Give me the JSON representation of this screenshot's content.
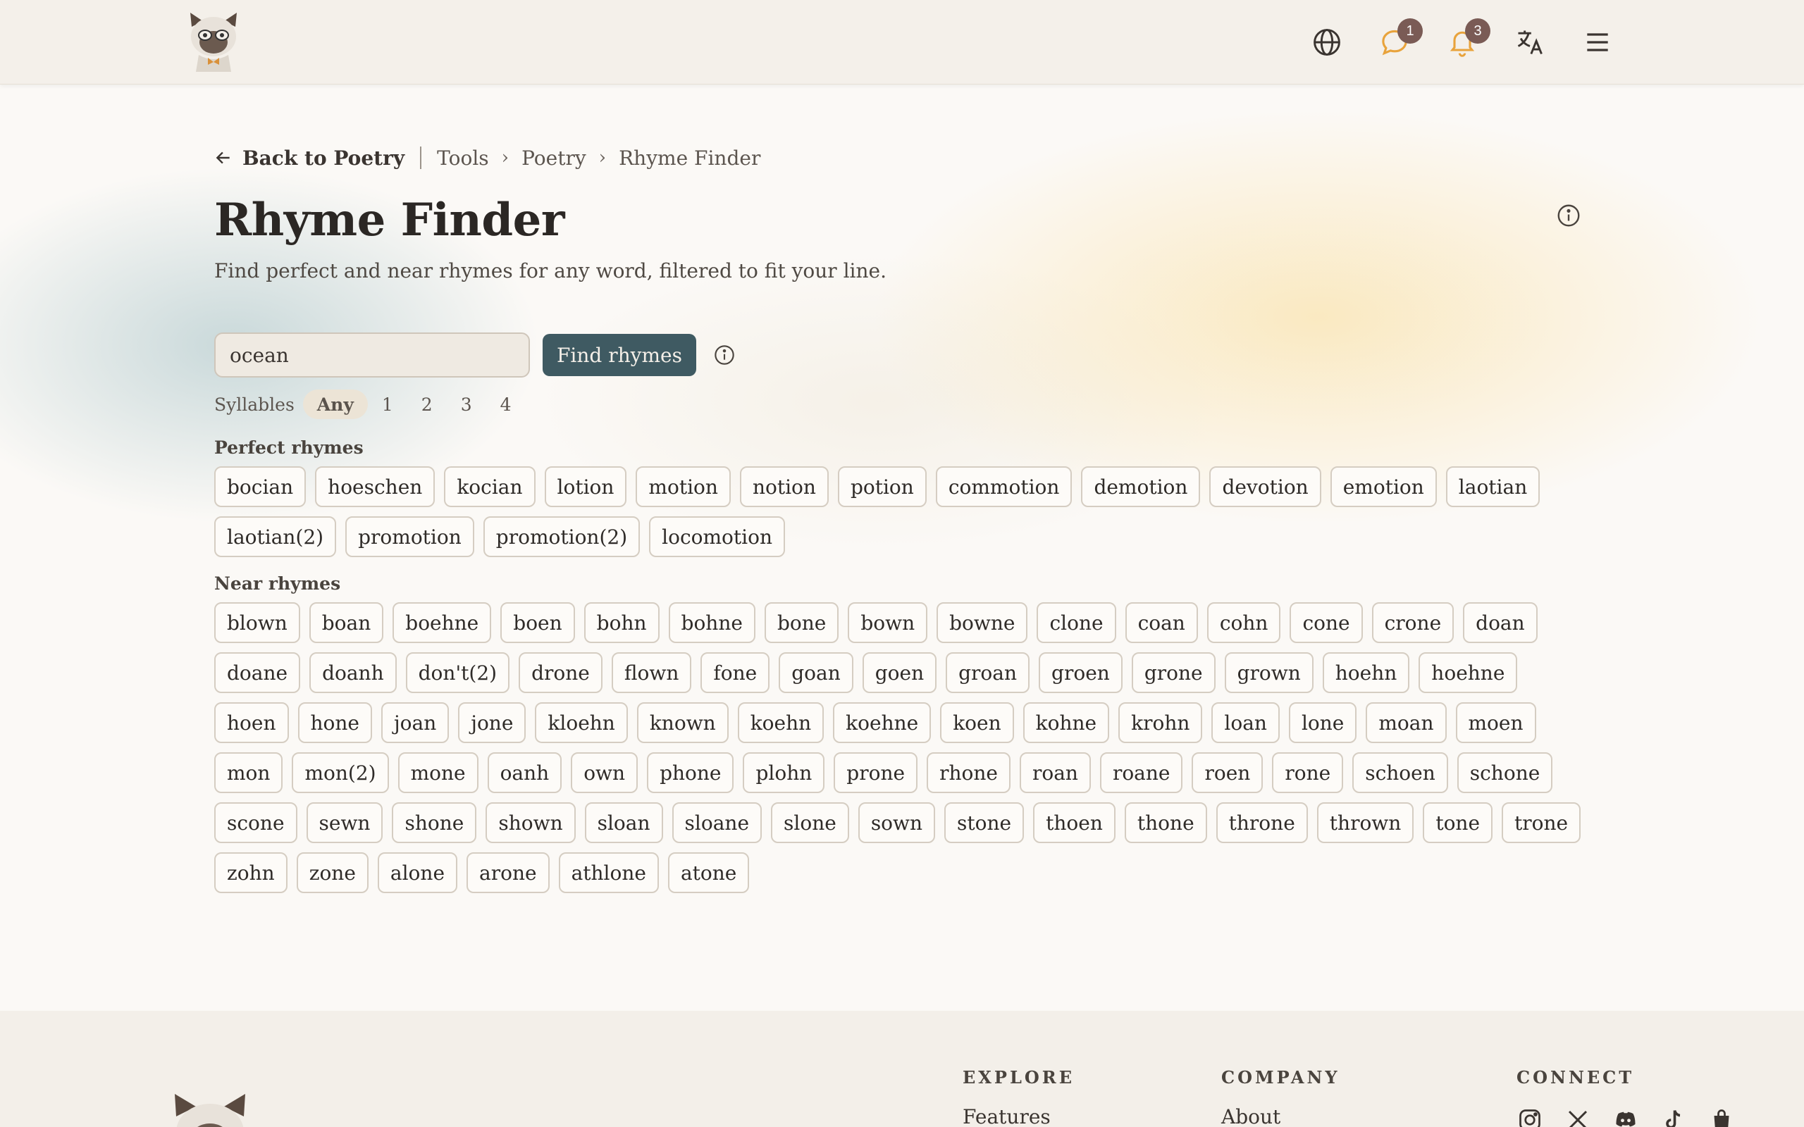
{
  "header": {
    "logo_alt": "cat mascot logo",
    "icons": [
      {
        "name": "globe-icon"
      },
      {
        "name": "chat-icon",
        "badge": "1",
        "color": "#e8a33c"
      },
      {
        "name": "bell-icon",
        "badge": "3",
        "color": "#e8a33c"
      },
      {
        "name": "translate-icon"
      },
      {
        "name": "menu-icon"
      }
    ]
  },
  "breadcrumb": {
    "back_label": "Back to Poetry",
    "items": [
      "Tools",
      "Poetry",
      "Rhyme Finder"
    ]
  },
  "page": {
    "title": "Rhyme Finder",
    "subtitle": "Find perfect and near rhymes for any word, filtered to fit your line."
  },
  "search": {
    "value": "ocean",
    "button_label": "Find rhymes"
  },
  "syllables": {
    "label": "Syllables",
    "options": [
      "Any",
      "1",
      "2",
      "3",
      "4"
    ],
    "selected": "Any"
  },
  "perfect": {
    "heading": "Perfect rhymes",
    "words": [
      "bocian",
      "hoeschen",
      "kocian",
      "lotion",
      "motion",
      "notion",
      "potion",
      "commotion",
      "demotion",
      "devotion",
      "emotion",
      "laotian",
      "laotian(2)",
      "promotion",
      "promotion(2)",
      "locomotion"
    ]
  },
  "near": {
    "heading": "Near rhymes",
    "words": [
      "blown",
      "boan",
      "boehne",
      "boen",
      "bohn",
      "bohne",
      "bone",
      "bown",
      "bowne",
      "clone",
      "coan",
      "cohn",
      "cone",
      "crone",
      "doan",
      "doane",
      "doanh",
      "don't(2)",
      "drone",
      "flown",
      "fone",
      "goan",
      "goen",
      "groan",
      "groen",
      "grone",
      "grown",
      "hoehn",
      "hoehne",
      "hoen",
      "hone",
      "joan",
      "jone",
      "kloehn",
      "known",
      "koehn",
      "koehne",
      "koen",
      "kohne",
      "krohn",
      "loan",
      "lone",
      "moan",
      "moen",
      "mon",
      "mon(2)",
      "mone",
      "oanh",
      "own",
      "phone",
      "plohn",
      "prone",
      "rhone",
      "roan",
      "roane",
      "roen",
      "rone",
      "schoen",
      "schone",
      "scone",
      "sewn",
      "shone",
      "shown",
      "sloan",
      "sloane",
      "slone",
      "sown",
      "stone",
      "thoen",
      "thone",
      "throne",
      "thrown",
      "tone",
      "trone",
      "zohn",
      "zone",
      "alone",
      "arone",
      "athlone",
      "atone"
    ]
  },
  "footer": {
    "explore": {
      "heading": "EXPLORE",
      "links": [
        "Features"
      ]
    },
    "company": {
      "heading": "COMPANY",
      "links": [
        "About"
      ]
    },
    "connect": {
      "heading": "CONNECT",
      "icons": [
        "instagram-icon",
        "x-icon",
        "discord-icon",
        "tiktok-icon",
        "shop-bag-icon"
      ]
    }
  },
  "colors": {
    "accent": "#3f5a62",
    "notification": "#e8a33c",
    "badge": "#7a5b55"
  }
}
